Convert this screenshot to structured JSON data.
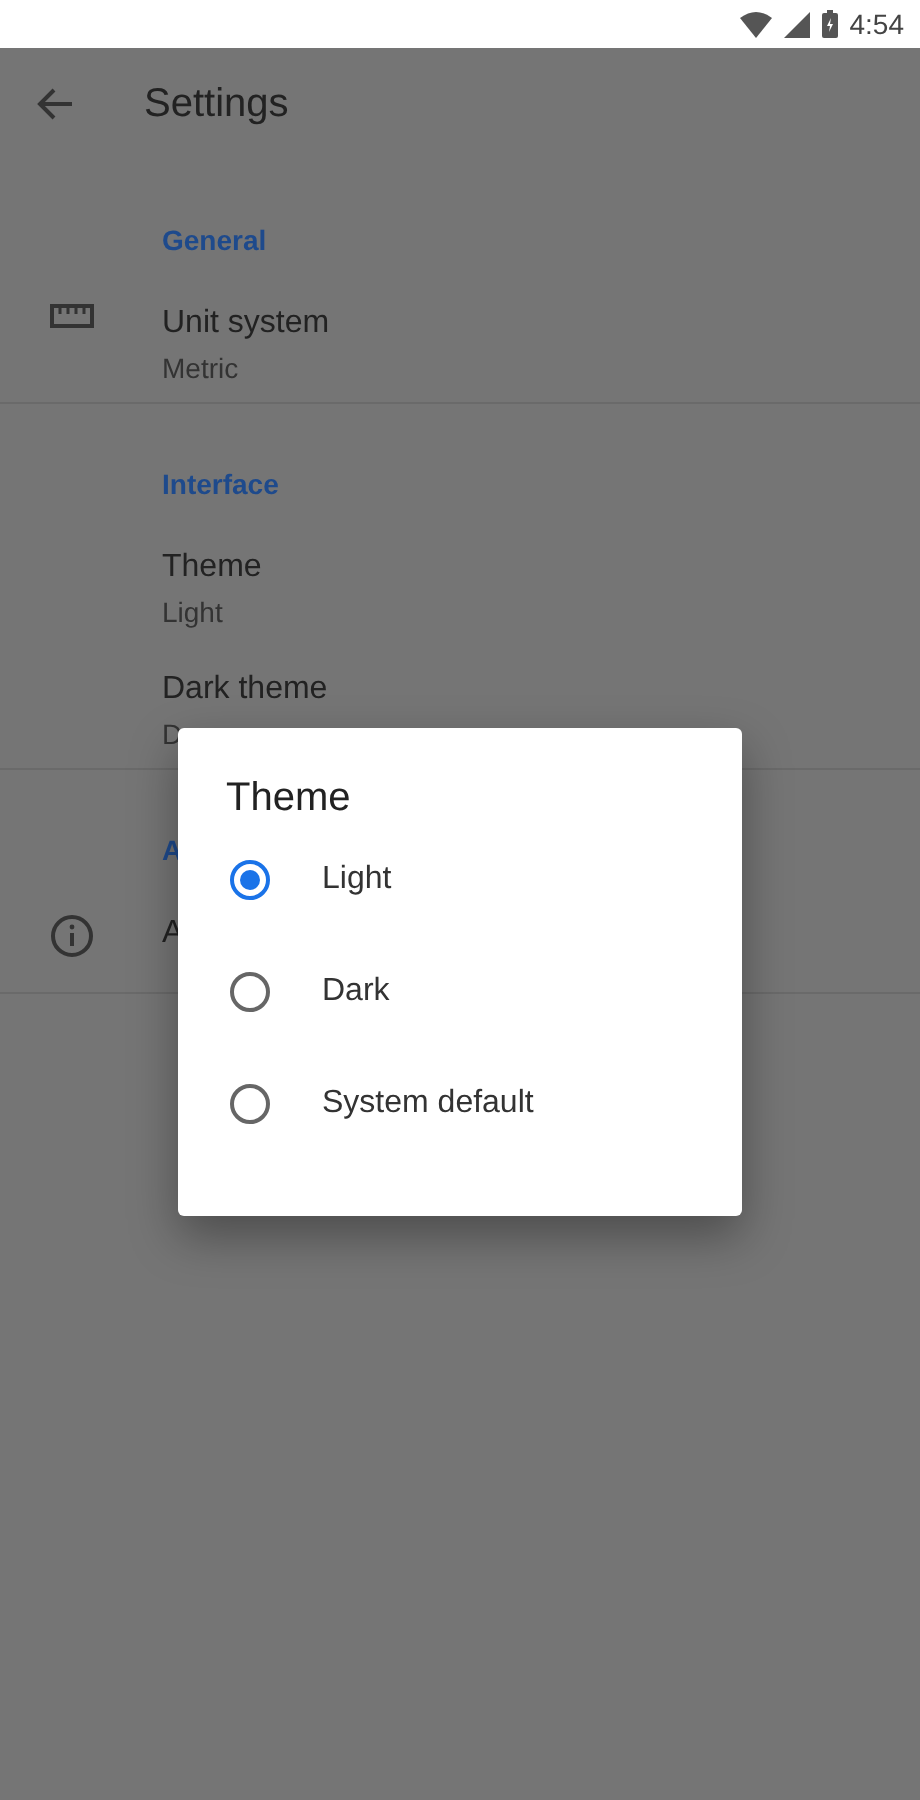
{
  "status_bar": {
    "time": "4:54"
  },
  "app_bar": {
    "title": "Settings"
  },
  "sections": [
    {
      "header": "General",
      "items": [
        {
          "title": "Unit system",
          "subtitle": "Metric"
        }
      ]
    },
    {
      "header": "Interface",
      "items": [
        {
          "title": "Theme",
          "subtitle": "Light"
        },
        {
          "title": "Dark theme",
          "subtitle": "D"
        }
      ]
    },
    {
      "header": "A",
      "items": [
        {
          "title": "A"
        }
      ]
    }
  ],
  "dialog": {
    "title": "Theme",
    "options": [
      {
        "label": "Light",
        "selected": true
      },
      {
        "label": "Dark",
        "selected": false
      },
      {
        "label": "System default",
        "selected": false
      }
    ]
  }
}
